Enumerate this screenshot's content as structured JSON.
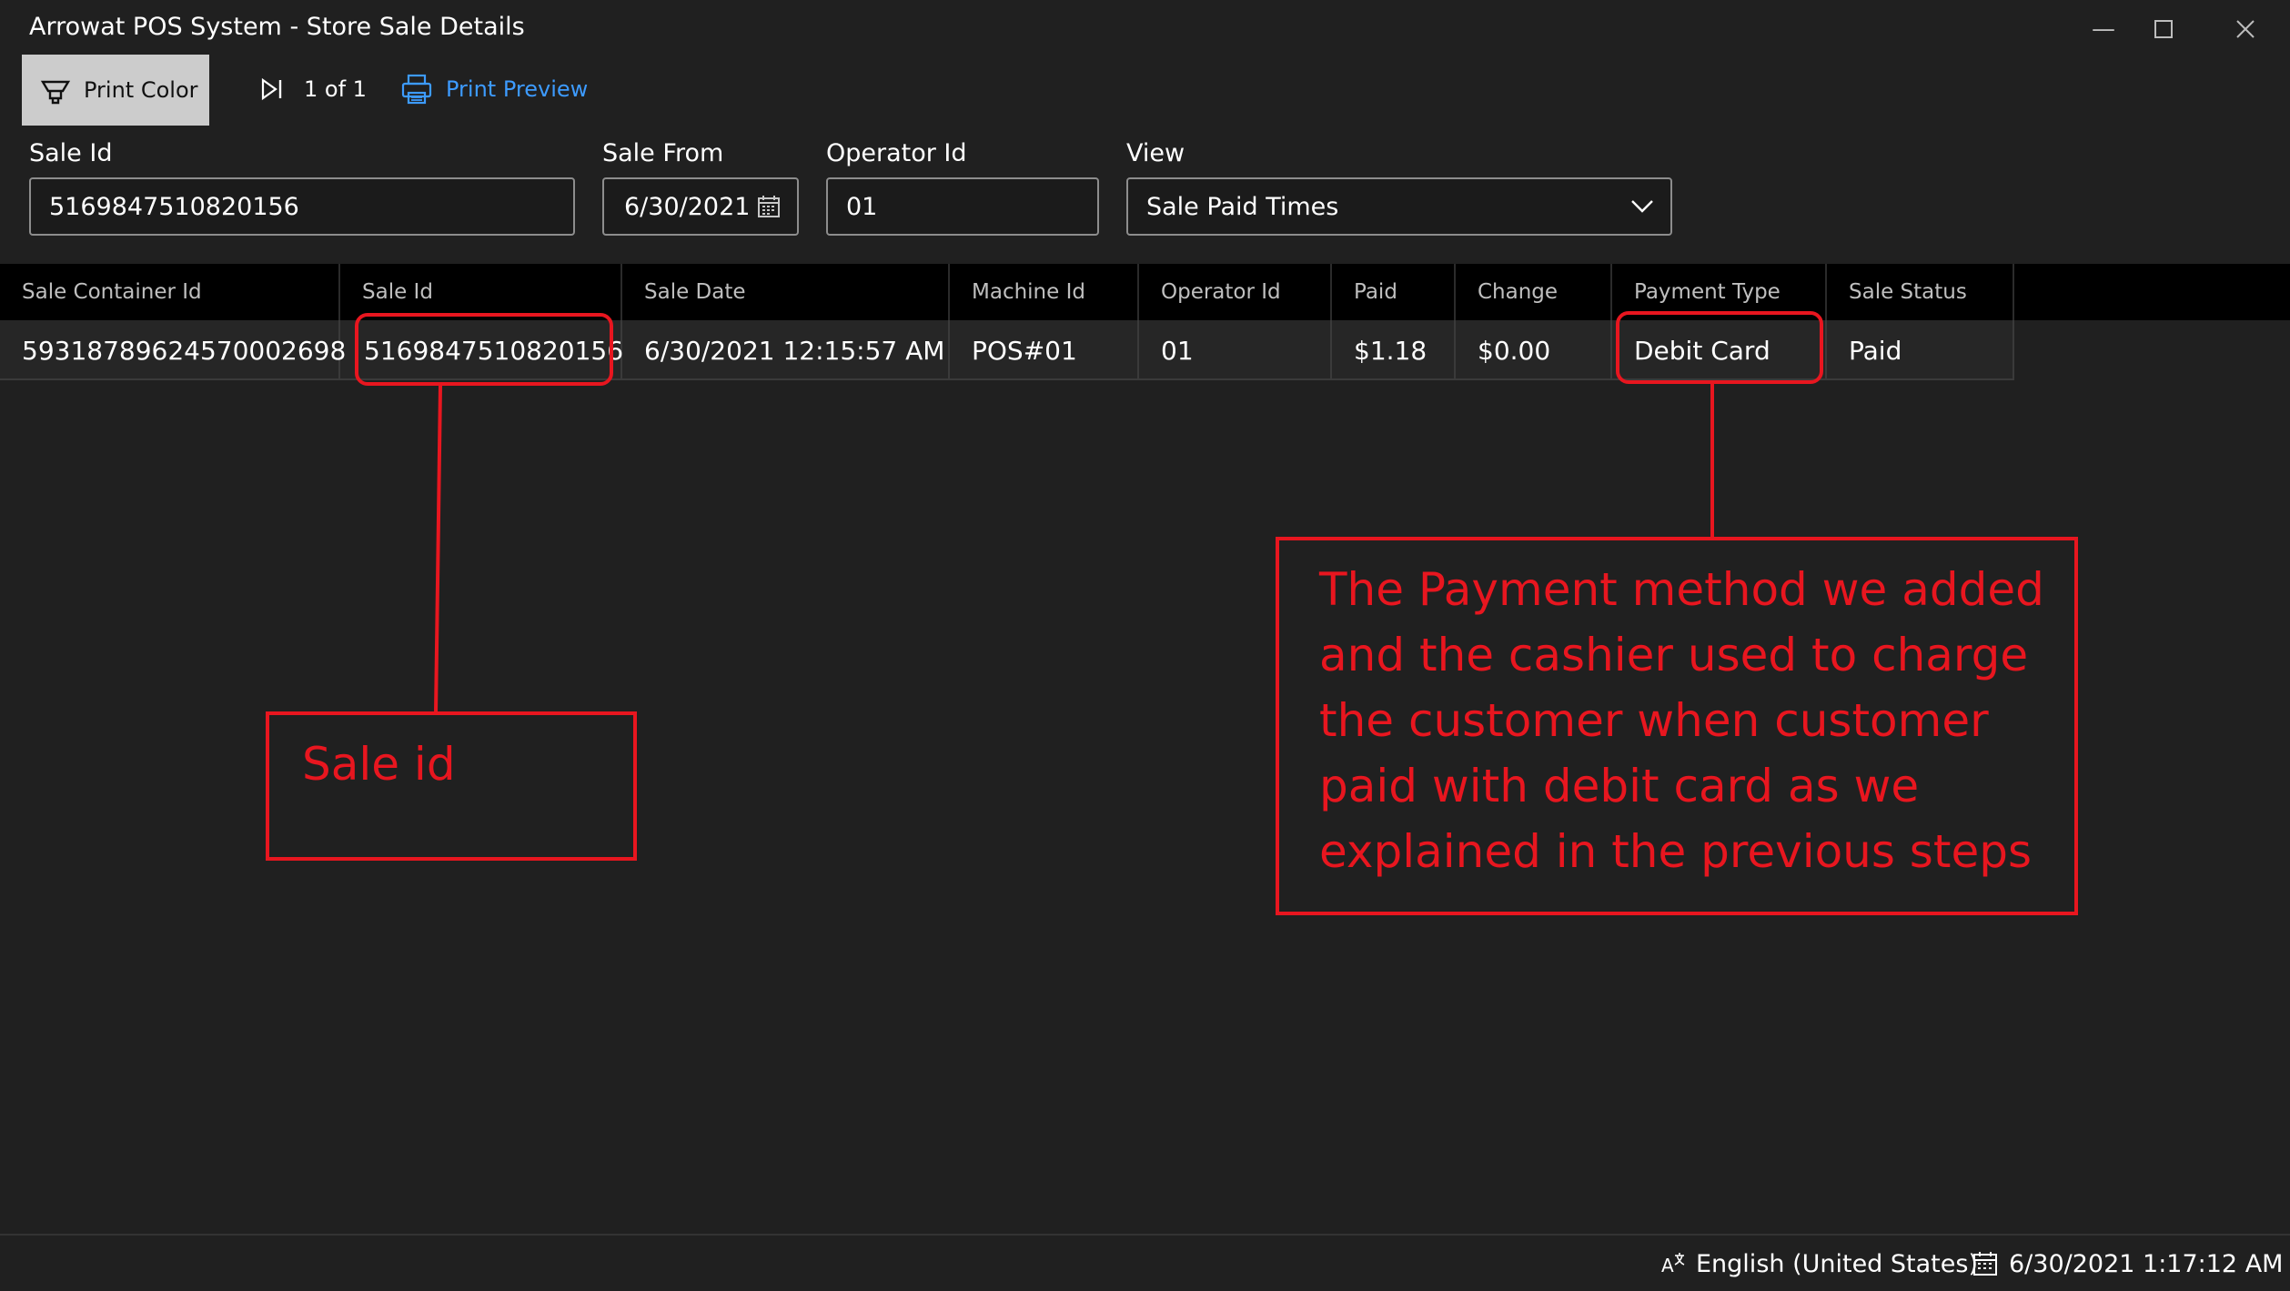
{
  "window": {
    "title": "Arrowat POS System - Store Sale Details",
    "controls": [
      "minimize-icon",
      "maximize-icon",
      "close-icon"
    ]
  },
  "toolbar": {
    "print_color_label": "Print Color",
    "pager_text": "1 of 1",
    "print_preview_label": "Print Preview"
  },
  "filters": {
    "sale_id_label": "Sale Id",
    "sale_id_value": "5169847510820156",
    "sale_from_label": "Sale From",
    "sale_from_value": "6/30/2021",
    "operator_id_label": "Operator Id",
    "operator_id_value": "01",
    "view_label": "View",
    "view_value": "Sale Paid Times"
  },
  "grid": {
    "columns": [
      "Sale Container Id",
      "Sale Id",
      "Sale Date",
      "Machine Id",
      "Operator Id",
      "Paid",
      "Change",
      "Payment Type",
      "Sale Status"
    ],
    "rows": [
      [
        "59318789624570002698",
        "5169847510820156",
        "6/30/2021 12:15:57 AM",
        "POS#01",
        "01",
        "$1.18",
        "$0.00",
        "Debit Card",
        "Paid"
      ]
    ]
  },
  "annotations": {
    "sale_id_note": "Sale id",
    "payment_note": "The Payment method we added and the cashier used to charge the customer when customer paid with debit card as we explained in the previous steps"
  },
  "status_bar": {
    "language": "English (United States)",
    "datetime": "6/30/2021 1:17:12 AM"
  },
  "colors": {
    "background": "#202020",
    "accent_link": "#3d9bff",
    "annotation_red": "#e8161f"
  }
}
